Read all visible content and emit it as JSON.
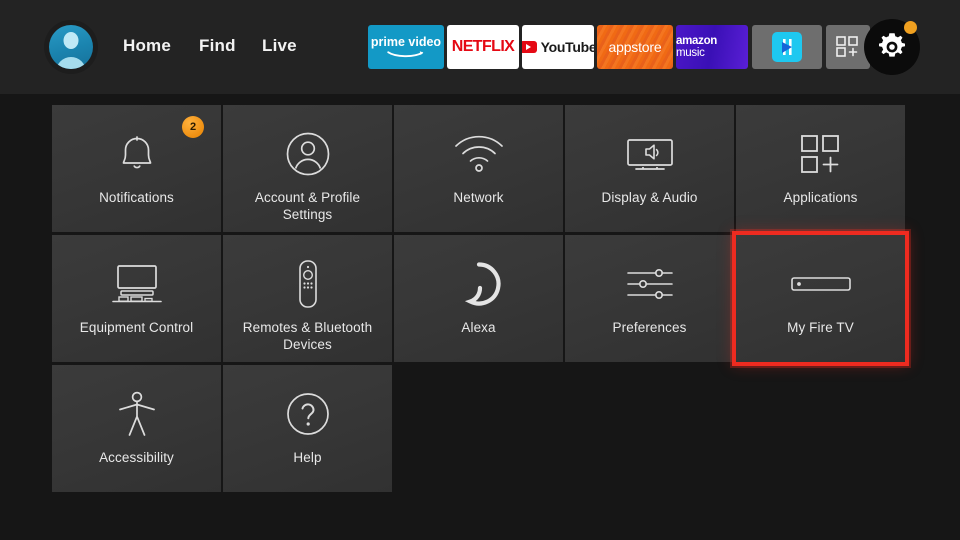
{
  "colors": {
    "page_background": "#161616",
    "topbar_background": "#232323",
    "tile_background": "#373737",
    "highlight_red": "#ee2b20",
    "badge_orange": "#ef8f11",
    "text": "#e8e8e8"
  },
  "topbar": {
    "avatar": {
      "name": "profile-avatar"
    },
    "nav": [
      {
        "id": "home",
        "label": "Home"
      },
      {
        "id": "find",
        "label": "Find"
      },
      {
        "id": "live",
        "label": "Live"
      }
    ],
    "apps": [
      {
        "id": "prime",
        "label": "prime video",
        "icon": "prime-video-icon"
      },
      {
        "id": "netflix",
        "label": "NETFLIX",
        "icon": "netflix-icon"
      },
      {
        "id": "youtube",
        "label": "YouTube",
        "icon": "youtube-icon"
      },
      {
        "id": "appstore",
        "label": "appstore",
        "icon": "appstore-icon"
      },
      {
        "id": "music",
        "label": "amazon music",
        "icon": "amazon-music-icon"
      },
      {
        "id": "generic",
        "label": "",
        "icon": "media-player-app-icon"
      },
      {
        "id": "grid",
        "label": "",
        "icon": "app-grid-plus-icon"
      }
    ],
    "settings_button": {
      "icon": "gear-icon",
      "has_notification_dot": true
    }
  },
  "grid": {
    "tiles": [
      {
        "id": "notifications",
        "label": "Notifications",
        "icon": "bell-icon",
        "badge": "2",
        "selected": false
      },
      {
        "id": "account",
        "label": "Account & Profile Settings",
        "icon": "person-circle-icon",
        "badge": null,
        "selected": false
      },
      {
        "id": "network",
        "label": "Network",
        "icon": "wifi-icon",
        "badge": null,
        "selected": false
      },
      {
        "id": "display",
        "label": "Display & Audio",
        "icon": "tv-speaker-icon",
        "badge": null,
        "selected": false
      },
      {
        "id": "applications",
        "label": "Applications",
        "icon": "apps-plus-icon",
        "badge": null,
        "selected": false
      },
      {
        "id": "equipment",
        "label": "Equipment Control",
        "icon": "tv-stand-icon",
        "badge": null,
        "selected": false
      },
      {
        "id": "remotes",
        "label": "Remotes & Bluetooth Devices",
        "icon": "remote-icon",
        "badge": null,
        "selected": false
      },
      {
        "id": "alexa",
        "label": "Alexa",
        "icon": "alexa-ring-icon",
        "badge": null,
        "selected": false
      },
      {
        "id": "preferences",
        "label": "Preferences",
        "icon": "sliders-icon",
        "badge": null,
        "selected": false
      },
      {
        "id": "myfiretv",
        "label": "My Fire TV",
        "icon": "fire-tv-stick-icon",
        "badge": null,
        "selected": true
      },
      {
        "id": "accessibility",
        "label": "Accessibility",
        "icon": "accessibility-icon",
        "badge": null,
        "selected": false
      },
      {
        "id": "help",
        "label": "Help",
        "icon": "question-circle-icon",
        "badge": null,
        "selected": false
      }
    ]
  }
}
